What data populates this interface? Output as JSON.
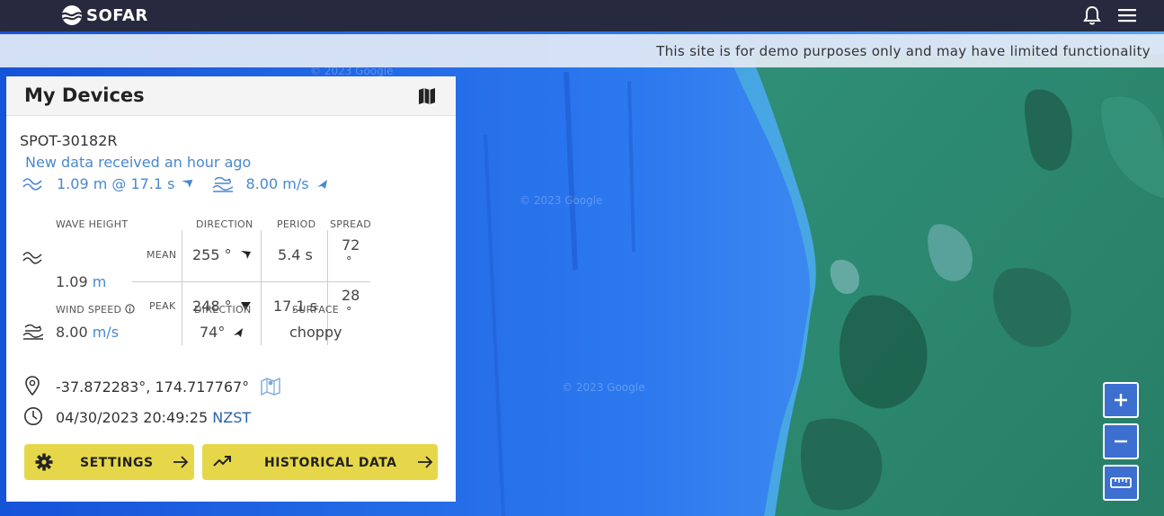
{
  "header": {
    "logo_text": "SOFAR",
    "icons": [
      "bell-icon",
      "hamburger-menu-icon"
    ]
  },
  "banner": {
    "text": "This site is for demo purposes only and may have limited functionality"
  },
  "map": {
    "watermark": "© 2023 Google"
  },
  "panel": {
    "title": "My Devices",
    "device_name": "SPOT-30182R",
    "status": "New data received an hour ago",
    "summary": {
      "wave": "1.09 m @ 17.1 s",
      "wind": "8.00 m/s"
    },
    "wave_table": {
      "headers": {
        "wave_height": "WAVE HEIGHT",
        "direction": "DIRECTION",
        "period": "PERIOD",
        "spread": "SPREAD"
      },
      "wave_height_value": "1.09",
      "wave_height_unit": "m",
      "mean": {
        "label": "MEAN",
        "direction": "255 °",
        "period": "5.4 s",
        "spread_value": "72",
        "spread_unit": "°"
      },
      "peak": {
        "label": "PEAK",
        "direction": "248 °",
        "period": "17.1 s",
        "spread_value": "28",
        "spread_unit": "°"
      }
    },
    "wind_table": {
      "headers": {
        "wind_speed": "WIND SPEED",
        "direction": "DIRECTION",
        "surface": "SURFACE"
      },
      "speed_value": "8.00",
      "speed_unit": "m/s",
      "direction": "74°",
      "surface": "choppy"
    },
    "location": "-37.872283°, 174.717767°",
    "timestamp": "04/30/2023 20:49:25",
    "timezone": "NZST",
    "buttons": {
      "settings": "SETTINGS",
      "historical": "HISTORICAL DATA"
    }
  },
  "colors": {
    "topbar": "#272a3e",
    "accent_blue": "#4a88d0",
    "button_yellow": "#e6d74a",
    "ocean": "#1a5fe0",
    "land": "#2b8a6e",
    "buoy": "#f1b72c"
  }
}
